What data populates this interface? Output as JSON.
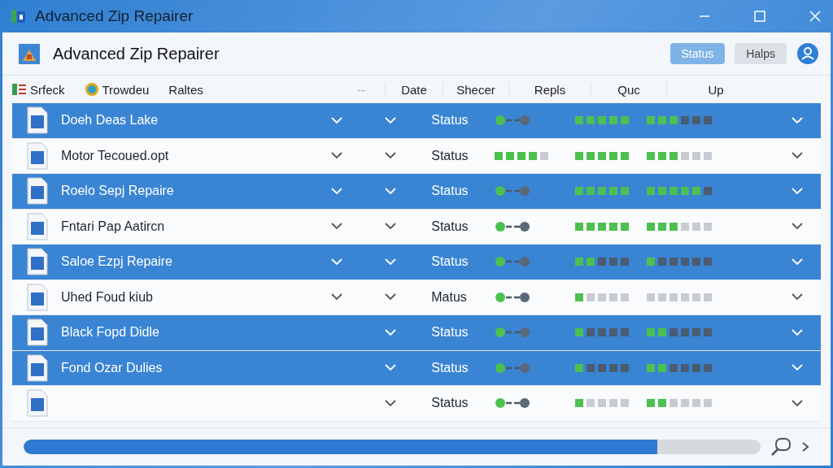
{
  "window": {
    "title": "Advanced Zip Repairer"
  },
  "header": {
    "title": "Advanced Zip Repairer",
    "buttons": [
      {
        "label": "Status",
        "selected": true
      },
      {
        "label": "Halps",
        "selected": false
      }
    ]
  },
  "toolbar": [
    {
      "label": "Srfeck"
    },
    {
      "label": "Trowdeu"
    },
    {
      "label": "Raltes"
    }
  ],
  "columns": [
    "--",
    "Date",
    "Shecer",
    "Repls",
    "Quc",
    "Up"
  ],
  "rows": [
    {
      "name": "Doeh Deas Lake",
      "selected": true,
      "chevron": true,
      "status": "Status",
      "kind": "link",
      "repairs": {
        "level": 1
      },
      "up": {
        "level": 0.5
      }
    },
    {
      "name": "Motor Tecoued.opt",
      "selected": false,
      "chevron": true,
      "status": "Status",
      "kind": "bar",
      "level": 0.8,
      "repairs": {
        "level": 1
      },
      "up": {
        "level": 0.5
      }
    },
    {
      "name": "Roelo Sepj Repaire",
      "selected": true,
      "chevron": true,
      "status": "Status",
      "kind": "link",
      "repairs": {
        "level": 1
      },
      "up": {
        "level": 0.83
      }
    },
    {
      "name": "Fntari Pap Aatircn",
      "selected": false,
      "chevron": true,
      "status": "Status",
      "kind": "link",
      "repairs": {
        "level": 1
      },
      "up": {
        "level": 0.5
      }
    },
    {
      "name": "Saloe Ezpj Repaire",
      "selected": true,
      "chevron": true,
      "status": "Status",
      "kind": "link",
      "repairs": {
        "level": 0.4
      },
      "up": {
        "level": 0.17
      }
    },
    {
      "name": "Uhed Foud kiub",
      "selected": false,
      "chevron": true,
      "status": "Matus",
      "kind": "link",
      "repairs": {
        "level": 0.2
      },
      "up": {
        "level": 0
      }
    },
    {
      "name": "Black Fopd Didle",
      "selected": true,
      "chevron": false,
      "status": "Status",
      "kind": "link",
      "repairs": {
        "level": 0.2
      },
      "up": {
        "level": 0.33
      }
    },
    {
      "name": "Fond Ozar Dulies",
      "selected": true,
      "chevron": false,
      "status": "Status",
      "kind": "link",
      "repairs": {
        "level": 0.2
      },
      "up": {
        "level": 0.33
      }
    },
    {
      "selected": false,
      "chevron": false,
      "status": "Status",
      "kind": "link",
      "repairs": {
        "level": 0.2
      },
      "up": {
        "level": 0.33
      }
    }
  ],
  "progress": {
    "level": 0.86
  }
}
